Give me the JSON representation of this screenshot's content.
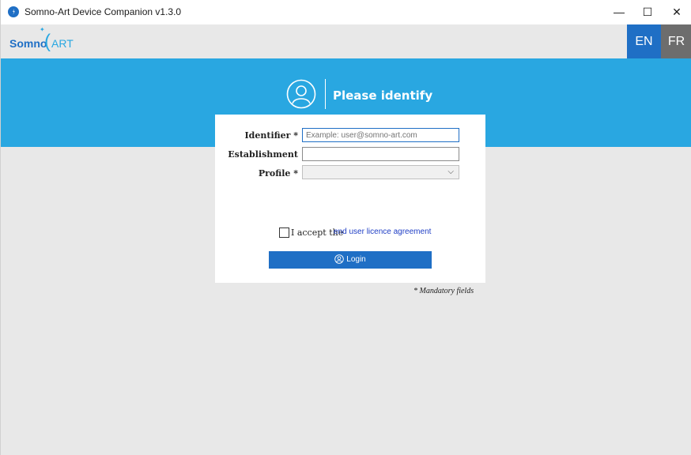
{
  "window": {
    "title": "Somno-Art Device Companion v1.3.0",
    "controls": {
      "minimize": "—",
      "maximize": "☐",
      "close": "✕"
    }
  },
  "header": {
    "logo_somno": "Somno",
    "logo_paren": "(",
    "logo_art": "ART",
    "lang_en": "EN",
    "lang_fr": "FR"
  },
  "banner": {
    "title": "Please identify"
  },
  "form": {
    "identifier_label": "Identifier *",
    "identifier_placeholder": "Example: user@somno-art.com",
    "establishment_label": "Establishment",
    "establishment_value": "",
    "profile_label": "Profile *",
    "profile_value": ""
  },
  "agreement": {
    "accept_text": "I accept the",
    "link_text": "end user licence agreement",
    "checked": false
  },
  "login": {
    "label": "Login"
  },
  "footer": {
    "mandatory_note": "* Mandatory fields"
  },
  "colors": {
    "primary": "#1f6fc5",
    "banner": "#29a7e1",
    "background": "#e8e8e8",
    "lang_inactive": "#6d6d6d"
  },
  "icons": {
    "app": "app-logo-icon",
    "user": "user-circle-icon",
    "login": "user-icon",
    "dropdown": "chevron-down-icon"
  }
}
